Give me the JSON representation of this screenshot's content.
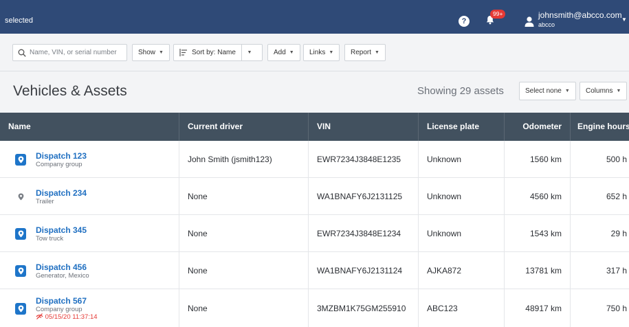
{
  "topbar": {
    "selected_text": "selected",
    "help_label": "?",
    "notifications_badge": "99+",
    "user_email": "johnsmith@abcco.com",
    "company": "abcco",
    "bar_color": "#2f4a77"
  },
  "toolbar": {
    "search_placeholder": "Name, VIN, or serial number",
    "show_label": "Show",
    "sort_label": "Sort by: Name",
    "add_label": "Add",
    "links_label": "Links",
    "report_label": "Report"
  },
  "header": {
    "title": "Vehicles & Assets",
    "showing_text": "Showing 29 assets",
    "select_none_label": "Select none",
    "columns_label": "Columns"
  },
  "table": {
    "columns": [
      "Name",
      "Current driver",
      "VIN",
      "License plate",
      "Odometer",
      "Engine hours"
    ],
    "header_color": "#42515f",
    "rows": [
      {
        "name": "Dispatch 123",
        "sub": "Company group",
        "alert": "",
        "icon": "location-pin-icon",
        "driver": "John Smith (jsmith123)",
        "vin": "EWR7234J3848E1235",
        "plate": "Unknown",
        "odometer": "1560 km",
        "hours": "500 h"
      },
      {
        "name": "Dispatch 234",
        "sub": "Trailer",
        "alert": "",
        "icon": "trailer-pin-icon",
        "driver": "None",
        "vin": "WA1BNAFY6J2131125",
        "plate": "Unknown",
        "odometer": "4560 km",
        "hours": "652 h"
      },
      {
        "name": "Dispatch 345",
        "sub": "Tow truck",
        "alert": "",
        "icon": "location-pin-icon",
        "driver": "None",
        "vin": "EWR7234J3848E1234",
        "plate": "Unknown",
        "odometer": "1543 km",
        "hours": "29 h"
      },
      {
        "name": "Dispatch 456",
        "sub": "Generator, Mexico",
        "alert": "",
        "icon": "location-pin-icon",
        "driver": "None",
        "vin": "WA1BNAFY6J2131124",
        "plate": "AJKA872",
        "odometer": "13781 km",
        "hours": "317 h"
      },
      {
        "name": "Dispatch 567",
        "sub": "Company group",
        "alert": "05/15/20 11:37:14",
        "icon": "location-pin-icon",
        "driver": "None",
        "vin": "3MZBM1K75GM255910",
        "plate": "ABC123",
        "odometer": "48917 km",
        "hours": "750 h"
      }
    ]
  }
}
